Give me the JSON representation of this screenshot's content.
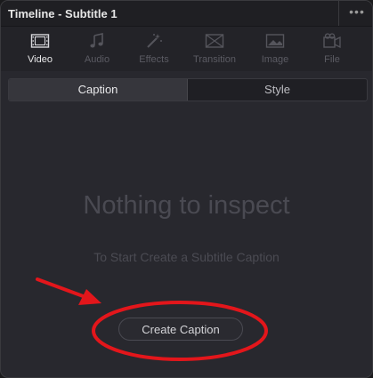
{
  "window": {
    "title": "Timeline - Subtitle 1",
    "menu_glyph": "•••"
  },
  "tabs": [
    {
      "label": "Video",
      "icon": "film-icon",
      "active": true
    },
    {
      "label": "Audio",
      "icon": "music-note-icon",
      "active": false
    },
    {
      "label": "Effects",
      "icon": "magic-wand-icon",
      "active": false
    },
    {
      "label": "Transition",
      "icon": "transition-icon",
      "active": false
    },
    {
      "label": "Image",
      "icon": "image-icon",
      "active": false
    },
    {
      "label": "File",
      "icon": "file-icon",
      "active": false
    }
  ],
  "segment": {
    "caption": "Caption",
    "style": "Style",
    "selected": "Caption"
  },
  "empty_state": {
    "title": "Nothing to inspect",
    "subtitle": "To Start Create a Subtitle Caption",
    "button": "Create Caption"
  },
  "colors": {
    "accent": "#e0533c",
    "annotation": "#e3161b",
    "panel": "#28282e"
  }
}
